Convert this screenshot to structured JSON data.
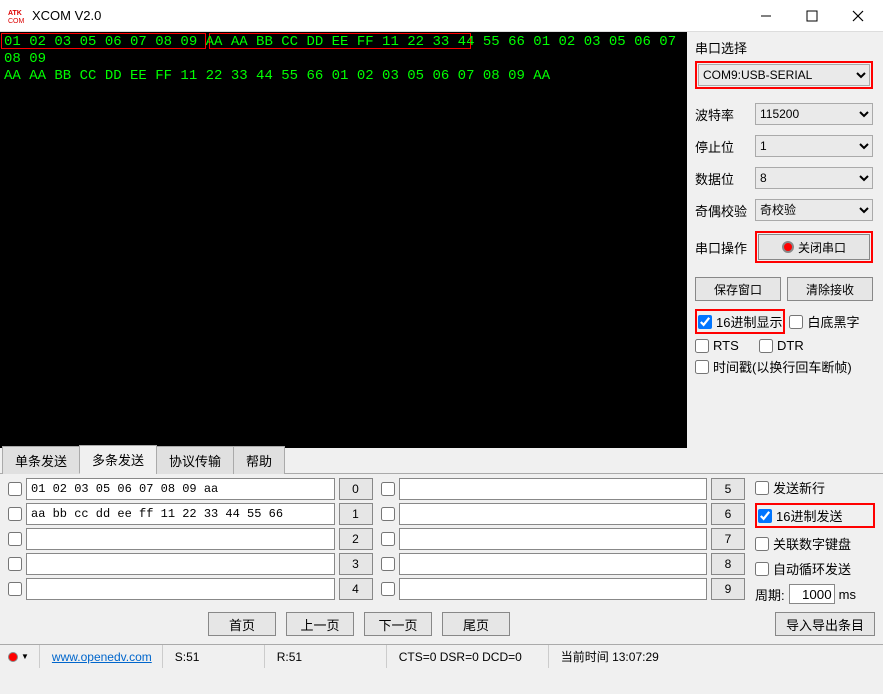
{
  "title": "XCOM V2.0",
  "terminal": {
    "line1": "01 02 03 05 06 07 08 09 AA AA BB CC DD EE FF 11 22 33 44 55 66 01 02 03 05 06 07 08 09",
    "line2": "AA AA BB CC DD EE FF 11 22 33 44 55 66 01 02 03 05 06 07 08 09 AA"
  },
  "side": {
    "port_section": "串口选择",
    "port_value": "COM9:USB-SERIAL",
    "baud_label": "波特率",
    "baud_value": "115200",
    "stop_label": "停止位",
    "stop_value": "1",
    "data_label": "数据位",
    "data_value": "8",
    "parity_label": "奇偶校验",
    "parity_value": "奇校验",
    "op_label": "串口操作",
    "op_button": "关闭串口",
    "save_window": "保存窗口",
    "clear_recv": "清除接收",
    "hex_display": "16进制显示",
    "white_bg": "白底黑字",
    "rts": "RTS",
    "dtr": "DTR",
    "timestamp": "时间戳(以换行回车断帧)"
  },
  "tabs": {
    "single": "单条发送",
    "multi": "多条发送",
    "protocol": "协议传输",
    "help": "帮助"
  },
  "send": {
    "rows_left": [
      {
        "val": "01 02 03 05 06 07 08 09 aa",
        "btn": "0"
      },
      {
        "val": "aa bb cc dd ee ff 11 22 33 44 55 66",
        "btn": "1"
      },
      {
        "val": "",
        "btn": "2"
      },
      {
        "val": "",
        "btn": "3"
      },
      {
        "val": "",
        "btn": "4"
      }
    ],
    "rows_right": [
      {
        "val": "",
        "btn": "5"
      },
      {
        "val": "",
        "btn": "6"
      },
      {
        "val": "",
        "btn": "7"
      },
      {
        "val": "",
        "btn": "8"
      },
      {
        "val": "",
        "btn": "9"
      }
    ],
    "newline": "发送新行",
    "hex_send": "16进制发送",
    "numpad": "关联数字键盘",
    "autoloop": "自动循环发送",
    "period_label": "周期:",
    "period_value": "1000",
    "period_unit": "ms"
  },
  "nav": {
    "first": "首页",
    "prev": "上一页",
    "next": "下一页",
    "last": "尾页",
    "import_export": "导入导出条目"
  },
  "status": {
    "url": "www.openedv.com",
    "s": "S:51",
    "r": "R:51",
    "cts": "CTS=0 DSR=0 DCD=0",
    "time_label": "当前时间 13:07:29"
  }
}
